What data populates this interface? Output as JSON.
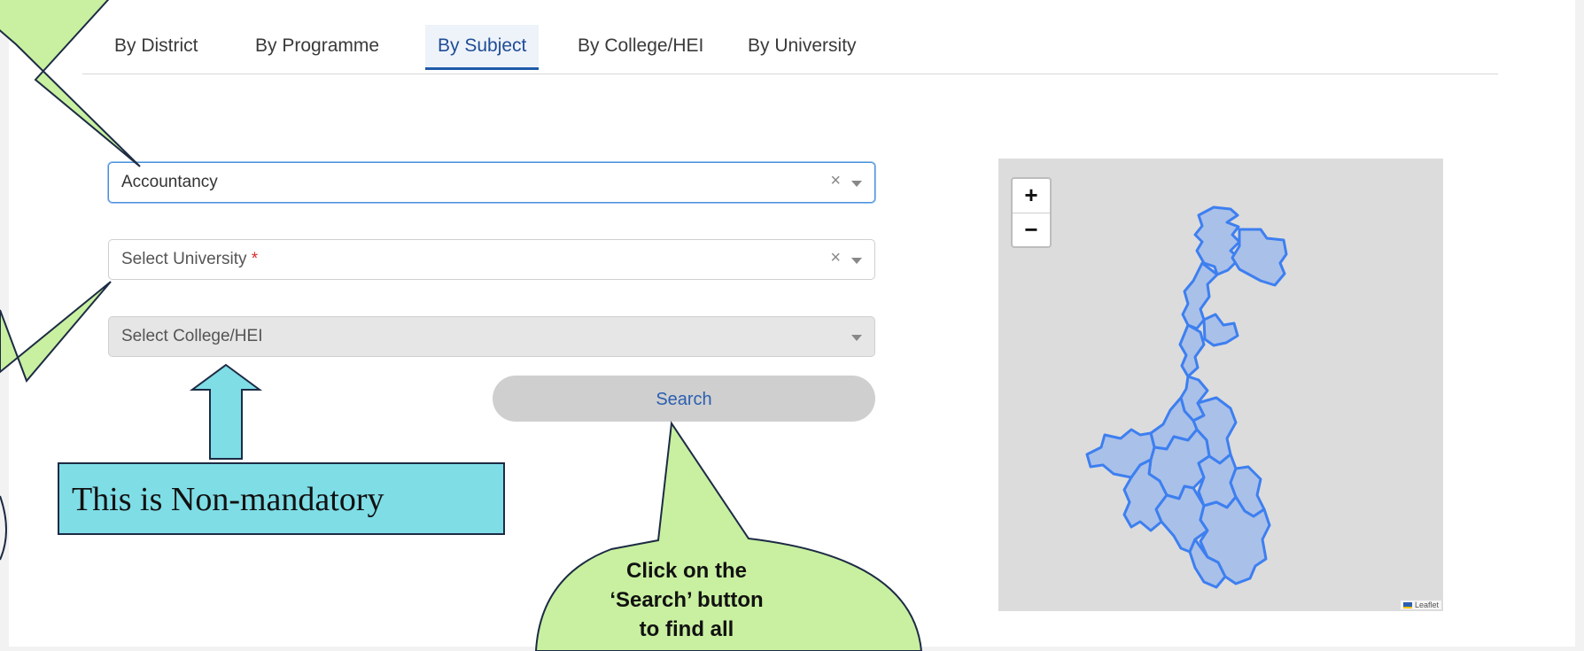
{
  "tabs": [
    "By District",
    "By Programme",
    "By Subject",
    "By College/HEI",
    "By University"
  ],
  "active_tab": "By Subject",
  "form": {
    "subject_value": "Accountancy",
    "university_placeholder": "Select University",
    "required_mark": "*",
    "college_placeholder": "Select College/HEI",
    "clear_glyph": "×",
    "search_label": "Search"
  },
  "map": {
    "zoom_in": "+",
    "zoom_out": "−",
    "attribution": "Leaflet",
    "region_fill": "#a9c0e8",
    "region_stroke": "#3d7ff0"
  },
  "annotations": {
    "note": "This is Non-mandatory",
    "bubble_lines": [
      "Click on the",
      "‘Search’ button",
      "to find all"
    ]
  },
  "colors": {
    "accent": "#1f5aa8",
    "callout_green": "#c8f0a0",
    "note_cyan": "#7fdde6"
  }
}
